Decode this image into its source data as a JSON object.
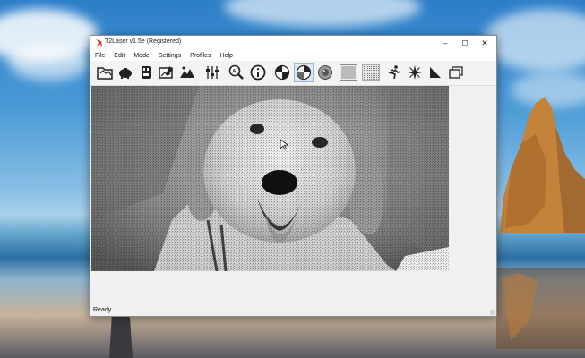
{
  "window": {
    "title": "T2Laser v1.5e (Registered)",
    "minimize_glyph": "–",
    "maximize_glyph": "☐",
    "close_glyph": "✕"
  },
  "menu": [
    "File",
    "Edit",
    "Mode",
    "Settings",
    "Profiles",
    "Help"
  ],
  "toolbar": {
    "icons": [
      "open-folder-icon",
      "save-piggy-icon",
      "usb-device-icon",
      "image-edit-icon",
      "landscape-image-icon",
      "sliders-icon",
      "zoom-icon",
      "info-icon",
      "dither-mode-1-icon",
      "dither-mode-2-icon",
      "grayscale-circle-icon",
      "lines-pattern-icon",
      "dots-pattern-icon",
      "running-man-icon",
      "compass-icon",
      "wedge-icon",
      "window-frames-icon"
    ],
    "active_tool": "dither-mode-2-icon"
  },
  "status": {
    "text": "Ready"
  },
  "colors": {
    "window_bg": "#f0f0f0",
    "titlebar_bg": "#ffffff",
    "active_tool_bg": "#dce9f6"
  }
}
